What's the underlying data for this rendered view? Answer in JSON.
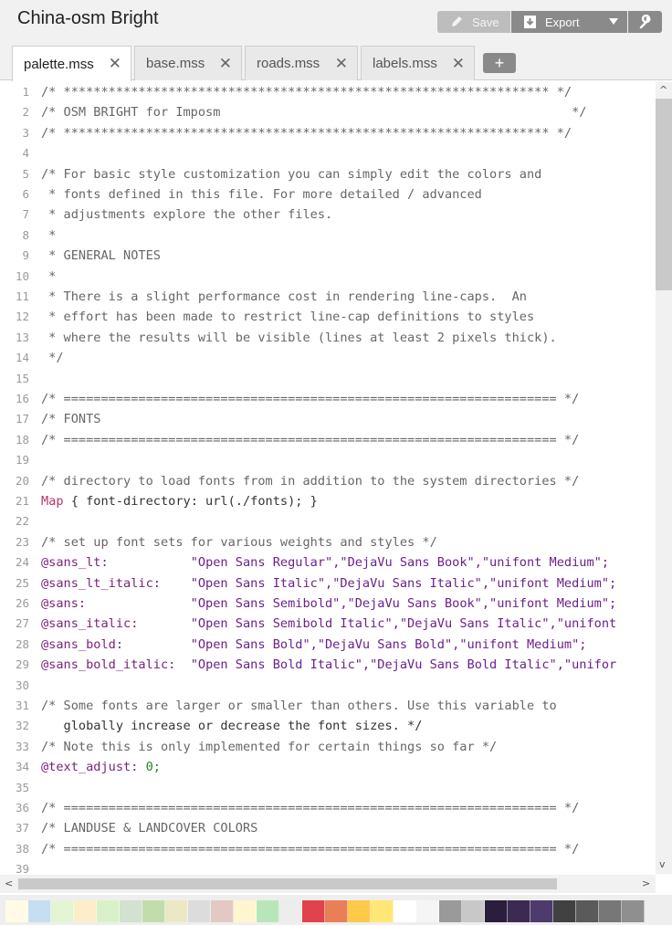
{
  "app": {
    "title": "China-osm Bright"
  },
  "toolbar": {
    "save_label": "Save",
    "export_label": "Export"
  },
  "tabs": [
    {
      "label": "palette.mss",
      "active": true
    },
    {
      "label": "base.mss",
      "active": false
    },
    {
      "label": "roads.mss",
      "active": false
    },
    {
      "label": "labels.mss",
      "active": false
    }
  ],
  "tab_close_glyph": "✕",
  "add_tab_label": "+",
  "line_numbers": [
    "1",
    "2",
    "3",
    "4",
    "5",
    "6",
    "7",
    "8",
    "9",
    "10",
    "11",
    "12",
    "13",
    "14",
    "15",
    "16",
    "17",
    "18",
    "19",
    "20",
    "21",
    "22",
    "23",
    "24",
    "25",
    "26",
    "27",
    "28",
    "29",
    "30",
    "31",
    "32",
    "33",
    "34",
    "35",
    "36",
    "37",
    "38",
    "39"
  ],
  "code_lines": [
    "/* ***************************************************************** */",
    "/* OSM BRIGHT for Imposm                                               */",
    "/* ***************************************************************** */",
    "",
    "/* For basic style customization you can simply edit the colors and",
    " * fonts defined in this file. For more detailed / advanced",
    " * adjustments explore the other files.",
    " *",
    " * GENERAL NOTES",
    " *",
    " * There is a slight performance cost in rendering line-caps.  An",
    " * effort has been made to restrict line-cap definitions to styles",
    " * where the results will be visible (lines at least 2 pixels thick).",
    " */",
    "",
    "/* ================================================================== */",
    "/* FONTS",
    "/* ================================================================== */",
    "",
    "/* directory to load fonts from in addition to the system directories */",
    "Map { font-directory: url(./fonts); }",
    "",
    "/* set up font sets for various weights and styles */",
    "@sans_lt:           \"Open Sans Regular\",\"DejaVu Sans Book\",\"unifont Medium\";",
    "@sans_lt_italic:    \"Open Sans Italic\",\"DejaVu Sans Italic\",\"unifont Medium\";",
    "@sans:              \"Open Sans Semibold\",\"DejaVu Sans Book\",\"unifont Medium\";",
    "@sans_italic:       \"Open Sans Semibold Italic\",\"DejaVu Sans Italic\",\"unifont",
    "@sans_bold:         \"Open Sans Bold\",\"DejaVu Sans Bold\",\"unifont Medium\";",
    "@sans_bold_italic:  \"Open Sans Bold Italic\",\"DejaVu Sans Bold Italic\",\"unifor",
    "",
    "/* Some fonts are larger or smaller than others. Use this variable to",
    "   globally increase or decrease the font sizes. */",
    "/* Note this is only implemented for certain things so far */",
    "@text_adjust: 0;",
    "",
    "/* ================================================================== */",
    "/* LANDUSE & LANDCOVER COLORS",
    "/* ================================================================== */",
    ""
  ],
  "scroll": {
    "up_glyph": "^",
    "down_glyph": "v",
    "left_glyph": "<",
    "right_glyph": ">"
  },
  "palette_colors": [
    "#fffbe6",
    "#c6def2",
    "#e3f5d3",
    "#fdedc9",
    "#d9f1c8",
    "#d2e1d0",
    "#c3ddaa",
    "#ece8c5",
    "#dcdcdc",
    "#e4c8c4",
    "#fff6d0",
    "#b9e6b9",
    "#ededed",
    "#e0434c",
    "#e87f57",
    "#ffc94a",
    "#ffe777",
    "#ffffff",
    "#f5f5f5",
    "#9a9a9a",
    "#c8c8c8",
    "#2a1d3d",
    "#3c2a53",
    "#4e3b6d",
    "#414141",
    "#5a5a5a",
    "#777777",
    "#8f8f8f"
  ]
}
